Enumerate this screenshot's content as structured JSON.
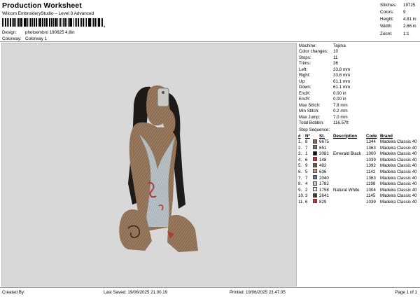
{
  "header": {
    "title": "Production Worksheet",
    "subtitle": "Wilcom EmbroideryStudio – Level 3 Advanced",
    "barcode_suffix": ",",
    "design_label": "Design:",
    "design_value": "photoembro 190625 4,8in",
    "colorway_label": "Colorway:",
    "colorway_value": "Colorway 1"
  },
  "stats": [
    {
      "label": "Stitches:",
      "value": "19725"
    },
    {
      "label": "Colors:",
      "value": "9"
    },
    {
      "label": "Height:",
      "value": "4.81 in"
    },
    {
      "label": "Width:",
      "value": "2.66 in"
    },
    {
      "label": "Zoom:",
      "value": "1:1"
    }
  ],
  "params": [
    {
      "label": "Machine:",
      "value": "Tajima"
    },
    {
      "label": "Color changes:",
      "value": "10"
    },
    {
      "label": "Stops:",
      "value": "11"
    },
    {
      "label": "Trims:",
      "value": "36"
    },
    {
      "label": "Left:",
      "value": "33.8 mm"
    },
    {
      "label": "Right:",
      "value": "33.8 mm"
    },
    {
      "label": "Up:",
      "value": "61.1 mm"
    },
    {
      "label": "Down:",
      "value": "61.1 mm"
    },
    {
      "label": "EndX:",
      "value": "0.00 in"
    },
    {
      "label": "EndY:",
      "value": "0.00 in"
    },
    {
      "label": "Max Stitch:",
      "value": "7.8 mm"
    },
    {
      "label": "Min Stitch:",
      "value": "0.2 mm"
    },
    {
      "label": "Max Jump:",
      "value": "7.0 mm"
    },
    {
      "label": "Total Bobbin:",
      "value": "116.57ft"
    }
  ],
  "stop_sequence": {
    "title": "Stop Sequence:",
    "headers": [
      "#",
      "Nº",
      "",
      "St.",
      "Description",
      "Code",
      "Brand"
    ],
    "rows": [
      {
        "num": "1.",
        "n": "8",
        "color": "#8a6a55",
        "st": "6675",
        "desc": "",
        "code": "1344",
        "brand": "Madeira Classic 40"
      },
      {
        "num": "2.",
        "n": "7",
        "color": "#6e7a88",
        "st": "651",
        "desc": "",
        "code": "1363",
        "brand": "Madeira Classic 40"
      },
      {
        "num": "3.",
        "n": "1",
        "color": "#111111",
        "st": "2081",
        "desc": "Emerald Black",
        "code": "1000",
        "brand": "Madeira Classic 40"
      },
      {
        "num": "4.",
        "n": "6",
        "color": "#c8323c",
        "st": "148",
        "desc": "",
        "code": "1039",
        "brand": "Madeira Classic 40"
      },
      {
        "num": "5.",
        "n": "9",
        "color": "#6b5a4a",
        "st": "482",
        "desc": "",
        "code": "1392",
        "brand": "Madeira Classic 40"
      },
      {
        "num": "6.",
        "n": "5",
        "color": "#c49a8c",
        "st": "636",
        "desc": "",
        "code": "1142",
        "brand": "Madeira Classic 40"
      },
      {
        "num": "7.",
        "n": "7",
        "color": "#6e7a88",
        "st": "2040",
        "desc": "",
        "code": "1363",
        "brand": "Madeira Classic 40"
      },
      {
        "num": "8.",
        "n": "4",
        "color": "#c4c8d6",
        "st": "1782",
        "desc": "",
        "code": "1198",
        "brand": "Madeira Classic 40"
      },
      {
        "num": "9.",
        "n": "2",
        "color": "#f4f2ea",
        "st": "1758",
        "desc": "Natural White",
        "code": "1004",
        "brand": "Madeira Classic 40"
      },
      {
        "num": "10.",
        "n": "3",
        "color": "#4a3528",
        "st": "2641",
        "desc": "",
        "code": "1145",
        "brand": "Madeira Classic 40"
      },
      {
        "num": "11.",
        "n": "6",
        "color": "#c8323c",
        "st": "829",
        "desc": "",
        "code": "1039",
        "brand": "Madeira Classic 40"
      }
    ]
  },
  "footer": {
    "created_by": "Created By:",
    "last_saved": "Last Saved: 19/06/2025 21.00.19",
    "printed": "Printed: 19/06/2025 23.47.05",
    "page": "Page 1 of 1"
  },
  "colors": {
    "canvas_bg": "#d8d8d8",
    "rule": "#9a9a9a"
  }
}
